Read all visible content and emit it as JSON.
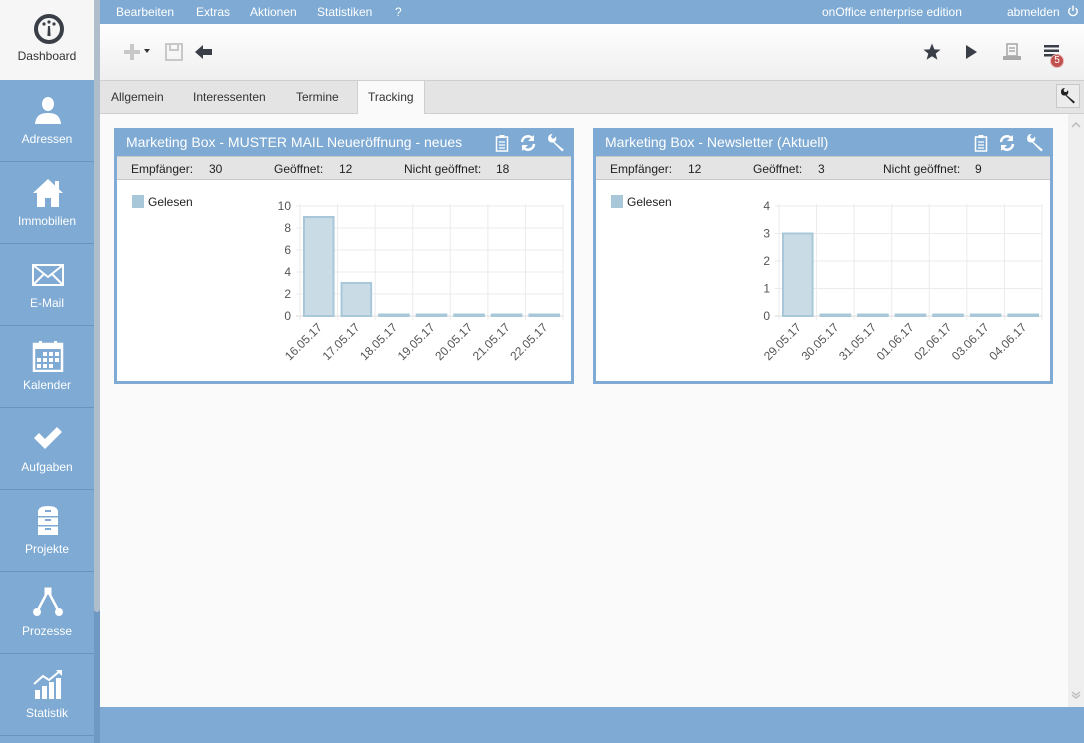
{
  "sidebar": {
    "dashboard": {
      "label": "Dashboard",
      "icon": "gauge-icon"
    },
    "items": [
      {
        "label": "Adressen",
        "icon": "person-icon"
      },
      {
        "label": "Immobilien",
        "icon": "house-icon"
      },
      {
        "label": "E-Mail",
        "icon": "envelope-icon"
      },
      {
        "label": "Kalender",
        "icon": "calendar-icon"
      },
      {
        "label": "Aufgaben",
        "icon": "checkmark-icon"
      },
      {
        "label": "Projekte",
        "icon": "cabinet-icon"
      },
      {
        "label": "Prozesse",
        "icon": "process-icon"
      },
      {
        "label": "Statistik",
        "icon": "chart-icon"
      }
    ]
  },
  "topmenu": {
    "items": [
      "Bearbeiten",
      "Extras",
      "Aktionen",
      "Statistiken",
      "?"
    ],
    "edition": "onOffice enterprise edition",
    "logout": "abmelden"
  },
  "toolbar": {
    "notification_count": "5"
  },
  "tabs": [
    {
      "label": "Allgemein",
      "active": false
    },
    {
      "label": "Interessenten",
      "active": false
    },
    {
      "label": "Termine",
      "active": false
    },
    {
      "label": "Tracking",
      "active": true
    }
  ],
  "colors": {
    "accent": "#7eaad3",
    "bar_fill": "#c9dce6",
    "bar_stroke": "#a8c8da",
    "badge": "#c0504d"
  },
  "widgets": [
    {
      "title": "Marketing Box - MUSTER MAIL Neueröffnung - neues",
      "stats": {
        "recipients_label": "Empfänger:",
        "recipients": "30",
        "opened_label": "Geöffnet:",
        "opened": "12",
        "not_opened_label": "Nicht geöffnet:",
        "not_opened": "18"
      },
      "legend": "Gelesen"
    },
    {
      "title": "Marketing Box - Newsletter (Aktuell)",
      "stats": {
        "recipients_label": "Empfänger:",
        "recipients": "12",
        "opened_label": "Geöffnet:",
        "opened": "3",
        "not_opened_label": "Nicht geöffnet:",
        "not_opened": "9"
      },
      "legend": "Gelesen"
    }
  ],
  "chart_data": [
    {
      "type": "bar",
      "title": "Marketing Box - MUSTER MAIL Neueröffnung - neues",
      "categories": [
        "16.05.17",
        "17.05.17",
        "18.05.17",
        "19.05.17",
        "20.05.17",
        "21.05.17",
        "22.05.17"
      ],
      "series": [
        {
          "name": "Gelesen",
          "values": [
            9,
            3,
            0,
            0,
            0,
            0,
            0
          ]
        }
      ],
      "yticks": [
        0,
        2,
        4,
        6,
        8,
        10
      ],
      "ylim": [
        0,
        10
      ],
      "xlabel": "",
      "ylabel": "",
      "grid": true,
      "legend": "top-left"
    },
    {
      "type": "bar",
      "title": "Marketing Box - Newsletter (Aktuell)",
      "categories": [
        "29.05.17",
        "30.05.17",
        "31.05.17",
        "01.06.17",
        "02.06.17",
        "03.06.17",
        "04.06.17"
      ],
      "series": [
        {
          "name": "Gelesen",
          "values": [
            3,
            0,
            0,
            0,
            0,
            0,
            0
          ]
        }
      ],
      "yticks": [
        0,
        1,
        2,
        3,
        4
      ],
      "ylim": [
        0,
        4
      ],
      "xlabel": "",
      "ylabel": "",
      "grid": true,
      "legend": "top-left"
    }
  ]
}
